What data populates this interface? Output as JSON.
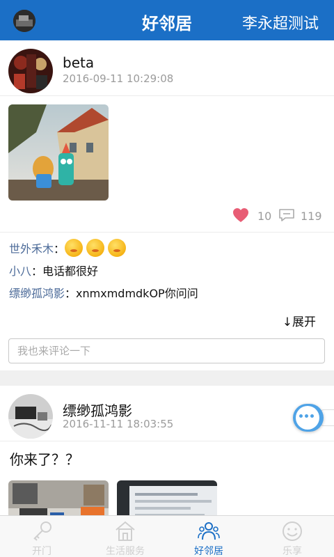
{
  "header": {
    "title": "好邻居",
    "right_link": "李永超测试"
  },
  "posts": [
    {
      "user": "beta",
      "time": "2016-09-11 10:29:08",
      "likes": "10",
      "comment_count": "119",
      "comments": [
        {
          "name": "世外禾木",
          "sep": "：",
          "emoji_count": 3
        },
        {
          "name": "小八",
          "sep": "：",
          "text": "电话都很好"
        },
        {
          "name": "缥缈孤鸿影",
          "sep": "：",
          "text": "xnmxmdmdkOP你问问"
        }
      ],
      "expand_label": "↓展开",
      "comment_placeholder": "我也来评论一下"
    },
    {
      "user": "缥缈孤鸿影",
      "time": "2016-11-11 18:03:55",
      "text": "你来了？？"
    }
  ],
  "tabs": [
    {
      "label": "开门",
      "icon": "key-icon",
      "active": false
    },
    {
      "label": "生活服务",
      "icon": "house-icon",
      "active": false
    },
    {
      "label": "好邻居",
      "icon": "neighbors-icon",
      "active": true
    },
    {
      "label": "乐享",
      "icon": "smile-icon",
      "active": false
    }
  ],
  "colors": {
    "brand": "#1b6fc6",
    "like": "#e85d75",
    "comment_name": "#4b6a98",
    "muted": "#9b9b9b"
  }
}
